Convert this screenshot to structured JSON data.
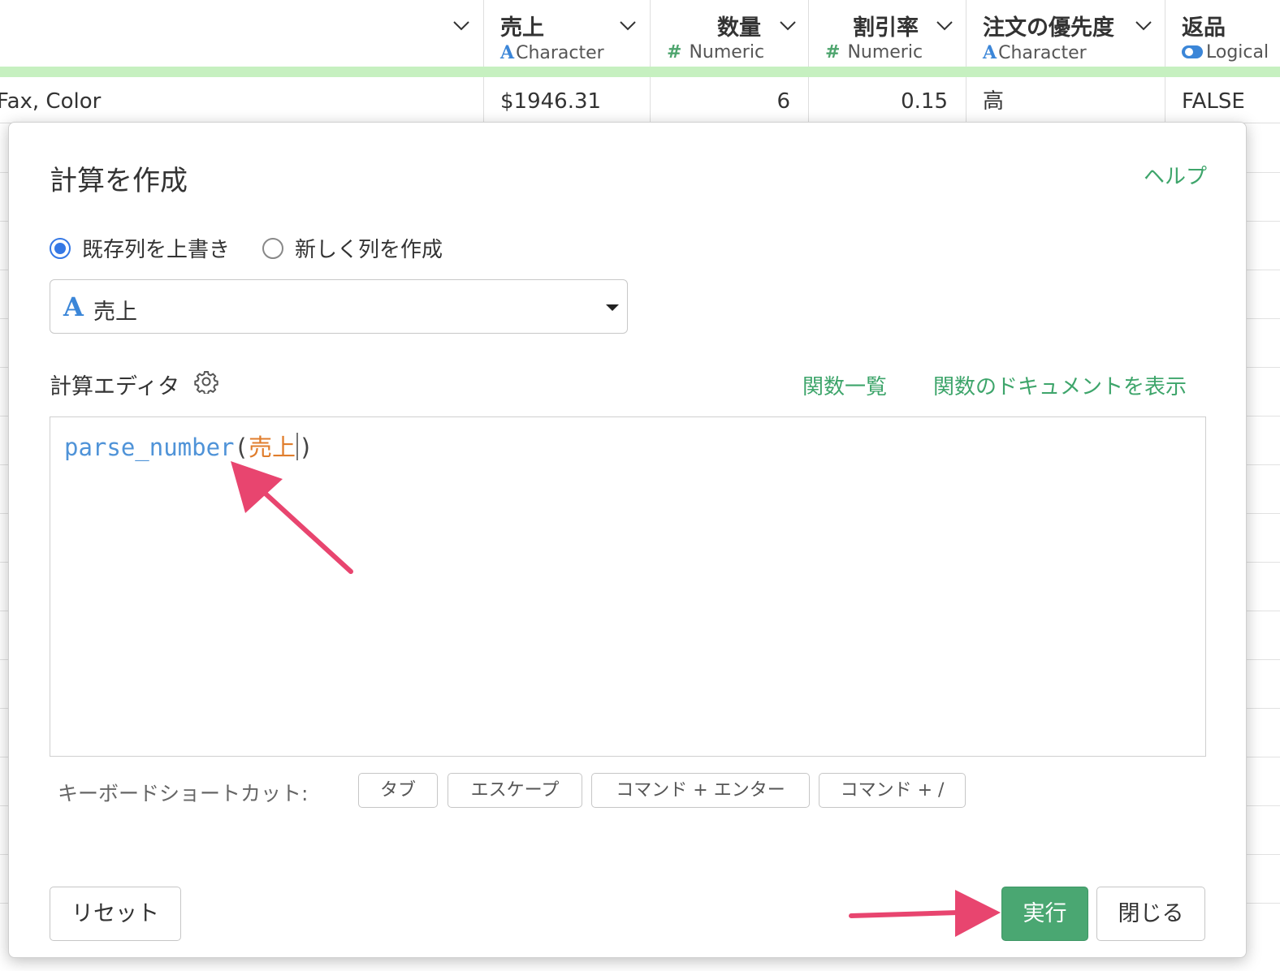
{
  "table": {
    "columns": [
      {
        "name": "",
        "type_icon": "",
        "type": ""
      },
      {
        "name": "売上",
        "type_icon": "character-icon",
        "type": "Character"
      },
      {
        "name": "数量",
        "type_icon": "numeric-icon",
        "type": "Numeric"
      },
      {
        "name": "割引率",
        "type_icon": "numeric-icon",
        "type": "Numeric"
      },
      {
        "name": "注文の優先度",
        "type_icon": "character-icon",
        "type": "Character"
      },
      {
        "name": "返品",
        "type_icon": "logical-icon",
        "type": "Logical"
      }
    ],
    "first_row": [
      "Fax, Color",
      "$1946.31",
      "6",
      "0.15",
      "高",
      "FALSE"
    ]
  },
  "icons": {
    "character": "A",
    "numeric": "#"
  },
  "modal": {
    "title": "計算を作成",
    "help": "ヘルプ",
    "mode_options": [
      {
        "label": "既存列を上書き",
        "checked": true
      },
      {
        "label": "新しく列を作成",
        "checked": false
      }
    ],
    "column_select": {
      "type_icon": "character-icon",
      "value": "売上"
    },
    "editor_label": "計算エディタ",
    "function_list_link": "関数一覧",
    "function_docs_link": "関数のドキュメントを表示",
    "code": {
      "function": "parse_number",
      "open_paren": "(",
      "argument": "売上",
      "close_paren": ")"
    },
    "shortcuts_label": "キーボードショートカット:",
    "shortcuts": [
      "タブ",
      "エスケープ",
      "コマンド + エンター",
      "コマンド + /"
    ],
    "buttons": {
      "reset": "リセット",
      "run": "実行",
      "close": "閉じる"
    }
  },
  "colors": {
    "accent_green": "#4aa772",
    "link_green": "#3ea56b",
    "annotation_pink": "#e8456f",
    "highlight_bar": "#c6f0c0",
    "function_blue": "#4f93d8",
    "argument_orange": "#e07d2c"
  }
}
